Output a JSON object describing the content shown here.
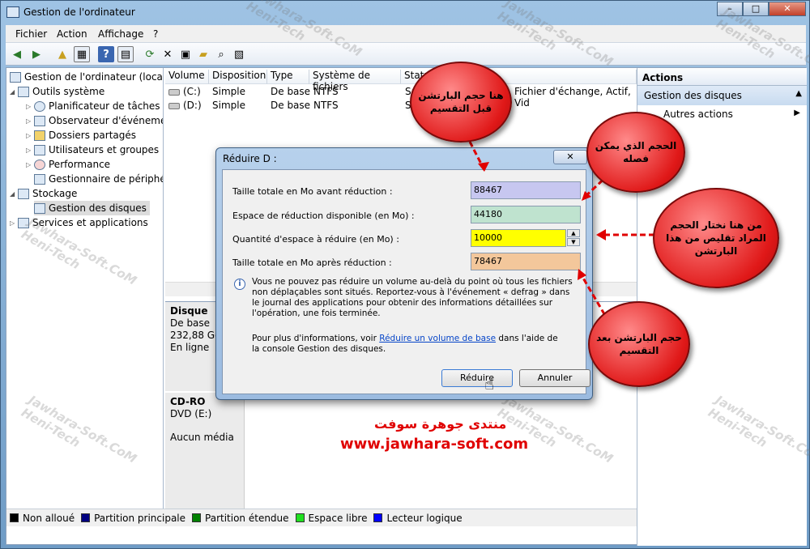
{
  "window": {
    "title": "Gestion de l'ordinateur",
    "buttons": [
      "–",
      "□",
      "✕"
    ]
  },
  "menu": [
    "Fichier",
    "Action",
    "Affichage",
    "?"
  ],
  "tree": [
    {
      "label": "Gestion de l'ordinateur (local)"
    },
    {
      "label": "Outils système"
    },
    {
      "label": "Planificateur de tâches"
    },
    {
      "label": "Observateur d'événeme"
    },
    {
      "label": "Dossiers partagés"
    },
    {
      "label": "Utilisateurs et groupes l"
    },
    {
      "label": "Performance"
    },
    {
      "label": "Gestionnaire de périphé"
    },
    {
      "label": "Stockage"
    },
    {
      "label": "Gestion des disques"
    },
    {
      "label": "Services et applications"
    }
  ],
  "volumes": {
    "headers": [
      "Volume",
      "Disposition",
      "Type",
      "Système de fichiers",
      "Statu"
    ],
    "rows": [
      [
        "(C:)",
        "Simple",
        "De base",
        "NTFS",
        "Sa"
      ],
      [
        "(D:)",
        "Simple",
        "De base",
        "NTFS",
        "Sa"
      ]
    ],
    "extra_status": "Fichier d'échange, Actif, Vid"
  },
  "disks": [
    {
      "name": "Disque",
      "type": "De base",
      "size": "232,88 Go",
      "state": "En ligne"
    },
    {
      "name": "CD-RO",
      "type": "DVD (E:)",
      "size": "",
      "state": "Aucun média"
    }
  ],
  "legend": [
    {
      "label": "Non alloué",
      "color": "#000000"
    },
    {
      "label": "Partition principale",
      "color": "#000080"
    },
    {
      "label": "Partition étendue",
      "color": "#008000"
    },
    {
      "label": "Espace libre",
      "color": "#20e020"
    },
    {
      "label": "Lecteur logique",
      "color": "#0000ff"
    }
  ],
  "actions": {
    "header": "Actions",
    "section": "Gestion des disques",
    "item": "Autres actions"
  },
  "dialog": {
    "title": "Réduire D :",
    "fields": [
      {
        "label": "Taille totale en Mo avant réduction :",
        "value": "88467",
        "color": "#c7c7f0"
      },
      {
        "label": "Espace de réduction disponible (en Mo) :",
        "value": "44180",
        "color": "#bfe3cf"
      },
      {
        "label": "Quantité d'espace à réduire (en Mo) :",
        "value": "10000",
        "color": "#ffff00"
      },
      {
        "label": "Taille totale en Mo après réduction :",
        "value": "78467",
        "color": "#f3c79b"
      }
    ],
    "info": "Vous ne pouvez pas réduire un volume au-delà du point où tous les fichiers non déplaçables sont situés. Reportez-vous à l'événement « defrag » dans le journal des applications pour obtenir des informations détaillées sur l'opération, une fois terminée.",
    "more_prefix": "Pour plus d'informations, voir ",
    "more_link": "Réduire un volume de base",
    "more_suffix": " dans l'aide de la console Gestion des disques.",
    "ok": "Réduire",
    "cancel": "Annuler"
  },
  "callouts": {
    "before": "هنا حجم البارتشن قبل التقسيم",
    "available": "الحجم الذي يمكن فصله",
    "choose": "من هنا نختار الحجم المراد تقليص من هذا البارتشن",
    "after": "حجم البارتشن بعد التقسيم"
  },
  "brand": {
    "arabic": "منتدى جوهرة سوفت",
    "url": "www.jawhara-soft.com"
  },
  "watermark": {
    "line1": "Jawhara-Soft.CoM",
    "line2": "Heni-Tech"
  }
}
